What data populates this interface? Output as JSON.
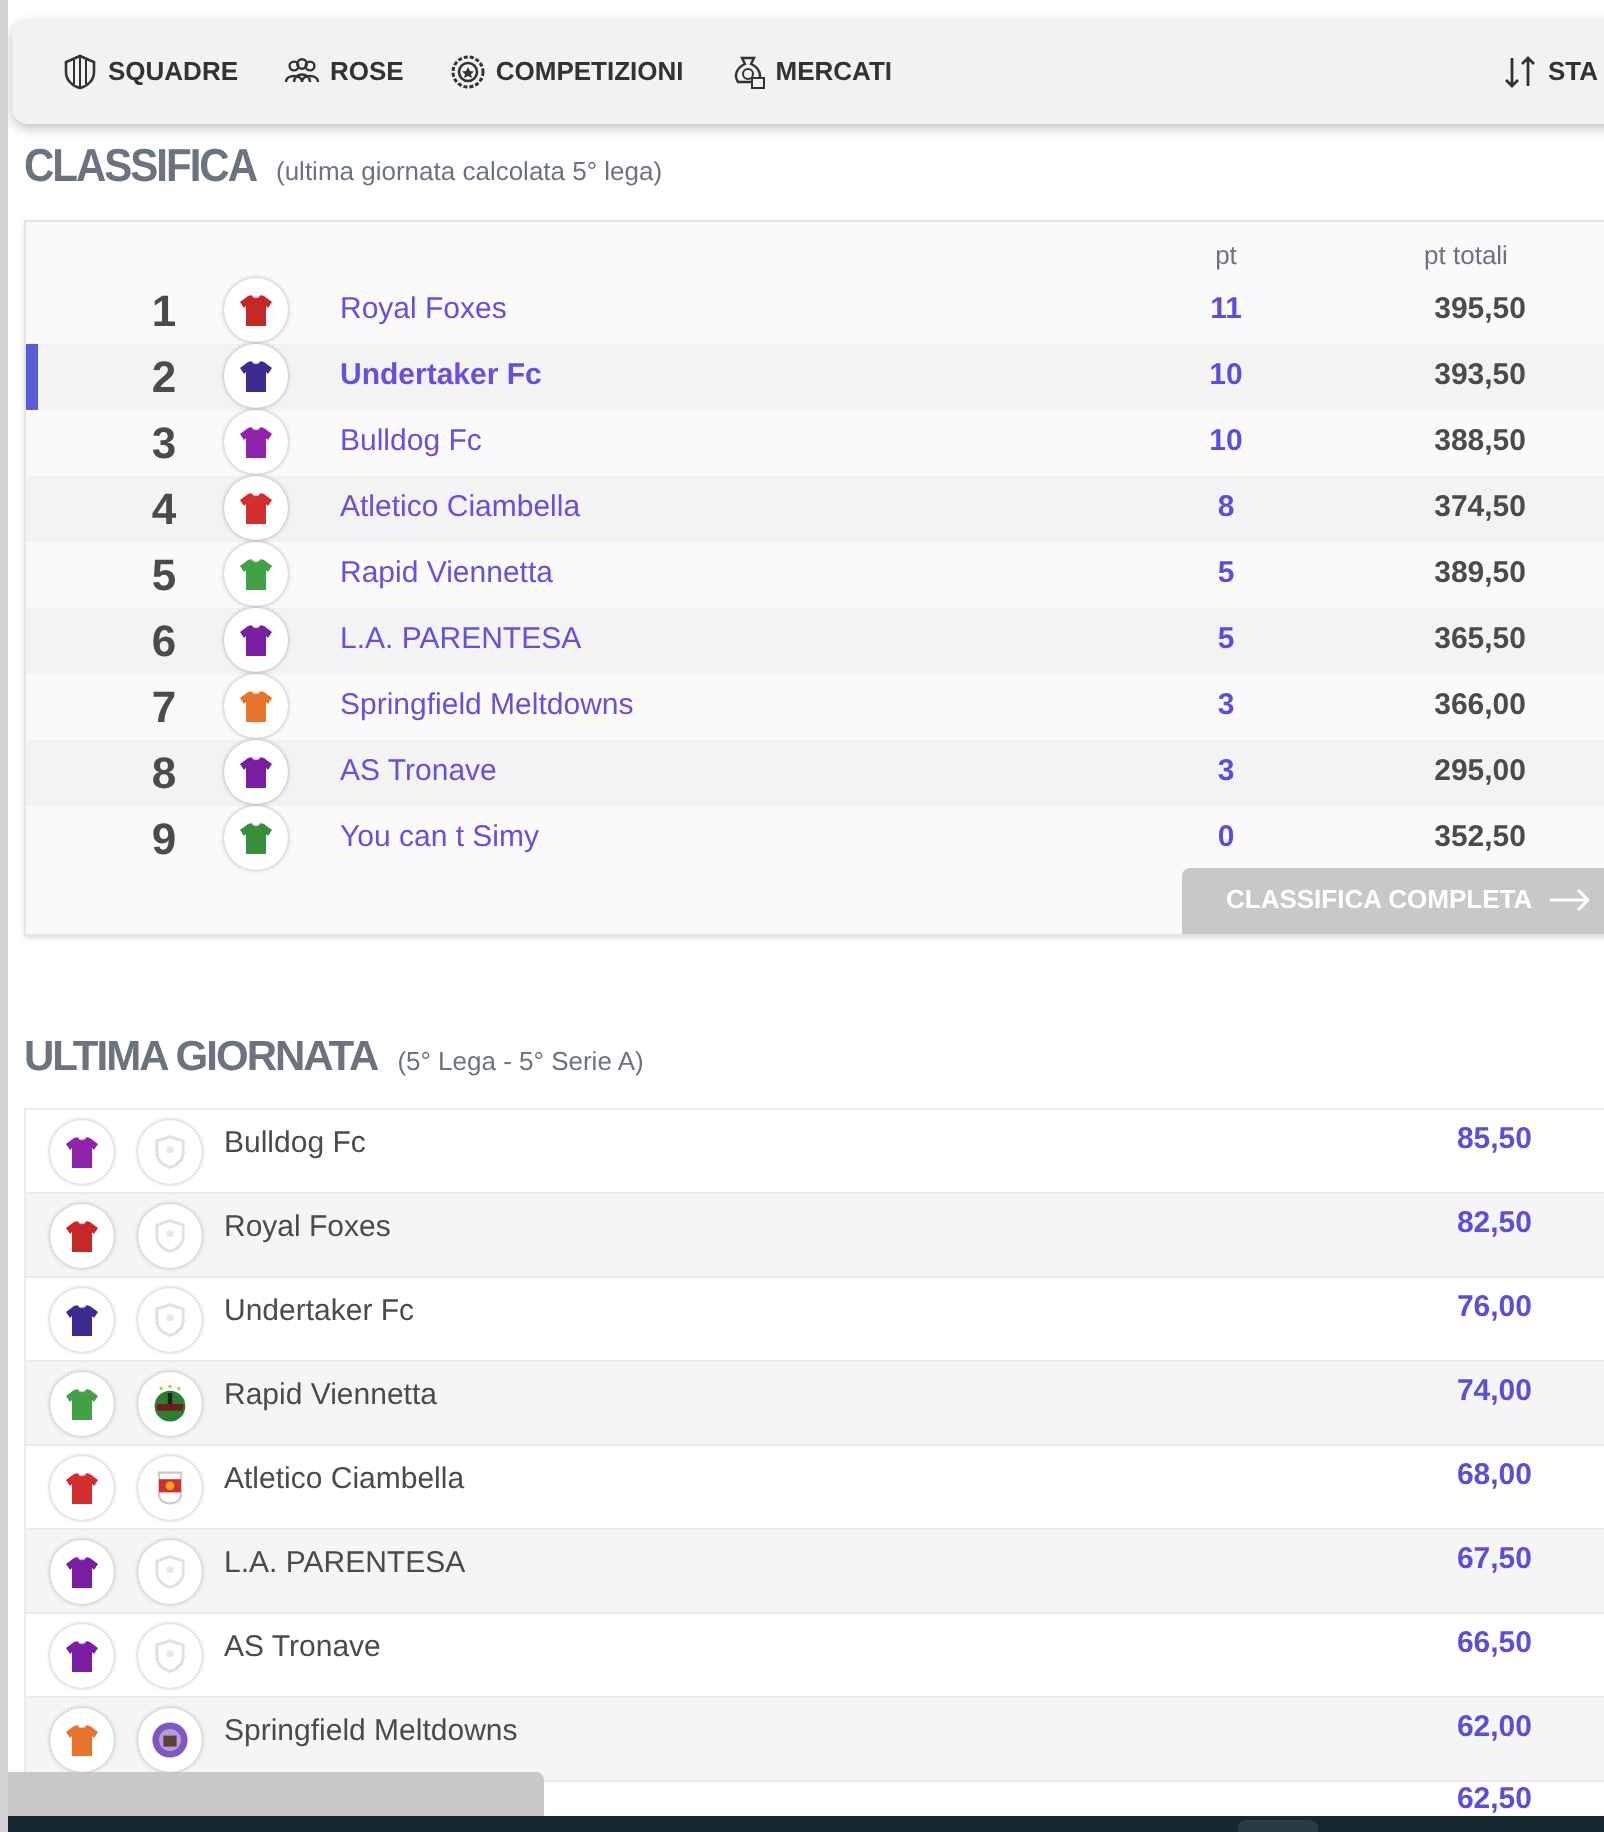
{
  "nav": {
    "items": [
      {
        "label": "SQUADRE",
        "kind": "shield"
      },
      {
        "label": "ROSE",
        "kind": "people"
      },
      {
        "label": "COMPETIZIONI",
        "kind": "badge"
      },
      {
        "label": "MERCATI",
        "kind": "money"
      }
    ],
    "cut_item": {
      "label": "STA",
      "kind": "sort"
    }
  },
  "classifica": {
    "title": "CLASSIFICA",
    "subtitle": "(ultima giornata calcolata 5° lega)",
    "columns": [
      "pt",
      "pt totali"
    ],
    "rows": [
      {
        "rank": "1",
        "team": "Royal Foxes",
        "color": "#c62828",
        "pt": "11",
        "total": "395,50",
        "selected": false
      },
      {
        "rank": "2",
        "team": "Undertaker Fc",
        "color": "#3a2d8f",
        "pt": "10",
        "total": "393,50",
        "selected": true
      },
      {
        "rank": "3",
        "team": "Bulldog Fc",
        "color": "#8e24aa",
        "pt": "10",
        "total": "388,50",
        "selected": false
      },
      {
        "rank": "4",
        "team": "Atletico Ciambella",
        "color": "#d32f2f",
        "pt": "8",
        "total": "374,50",
        "selected": false
      },
      {
        "rank": "5",
        "team": "Rapid Viennetta",
        "color": "#43a047",
        "pt": "5",
        "total": "389,50",
        "selected": false
      },
      {
        "rank": "6",
        "team": "L.A. PARENTESA",
        "color": "#7b1fa2",
        "pt": "5",
        "total": "365,50",
        "selected": false
      },
      {
        "rank": "7",
        "team": "Springfield Meltdowns",
        "color": "#e8732a",
        "pt": "3",
        "total": "366,00",
        "selected": false
      },
      {
        "rank": "8",
        "team": "AS Tronave",
        "color": "#7b1fa2",
        "pt": "3",
        "total": "295,00",
        "selected": false
      },
      {
        "rank": "9",
        "team": "You can t Simy",
        "color": "#388e3c",
        "pt": "0",
        "total": "352,50",
        "selected": false
      }
    ],
    "button": "CLASSIFICA COMPLETA"
  },
  "ultima_giornata": {
    "title": "ULTIMA GIORNATA",
    "subtitle": "(5° Lega - 5° Serie A)",
    "rows": [
      {
        "team": "Bulldog Fc",
        "color": "#8e24aa",
        "crest": {
          "kind": "placeholder"
        },
        "score": "85,50"
      },
      {
        "team": "Royal Foxes",
        "color": "#c62828",
        "crest": {
          "kind": "placeholder"
        },
        "score": "82,50"
      },
      {
        "team": "Undertaker Fc",
        "color": "#3a2d8f",
        "crest": {
          "kind": "placeholder"
        },
        "score": "76,00"
      },
      {
        "team": "Rapid Viennetta",
        "color": "#43a047",
        "crest": {
          "kind": "round"
        },
        "score": "74,00"
      },
      {
        "team": "Atletico Ciambella",
        "color": "#d32f2f",
        "crest": {
          "kind": "shield"
        },
        "score": "68,00"
      },
      {
        "team": "L.A. PARENTESA",
        "color": "#7b1fa2",
        "crest": {
          "kind": "placeholder"
        },
        "score": "67,50"
      },
      {
        "team": "AS Tronave",
        "color": "#7b1fa2",
        "crest": {
          "kind": "placeholder"
        },
        "score": "66,50"
      },
      {
        "team": "Springfield Meltdowns",
        "color": "#e8732a",
        "crest": {
          "kind": "purple"
        },
        "score": "62,00"
      },
      {
        "score": "62,50"
      }
    ]
  }
}
